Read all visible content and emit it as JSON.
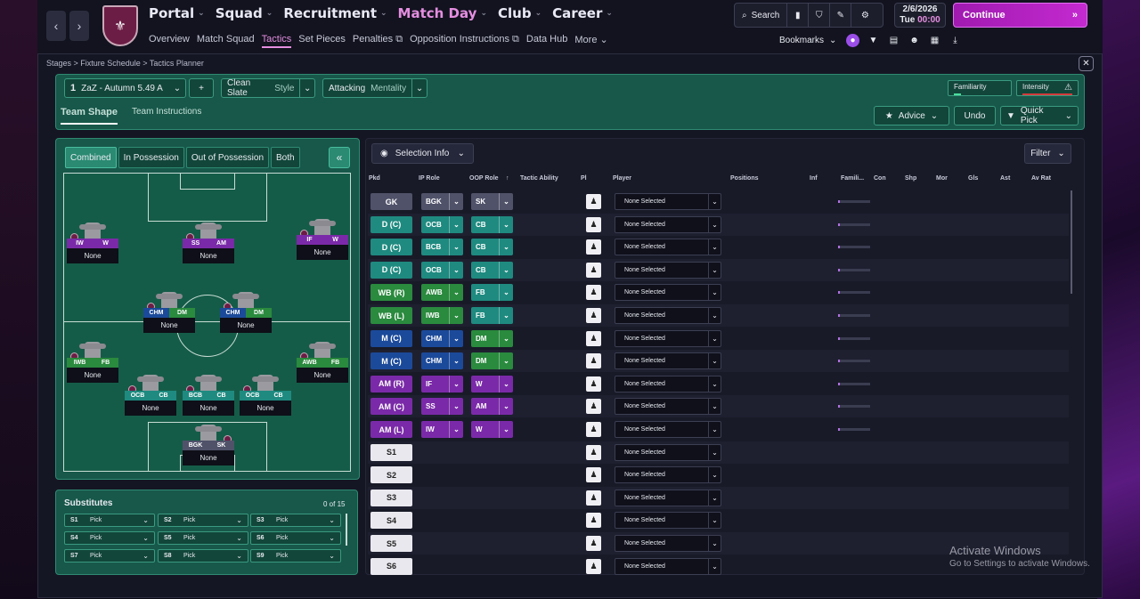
{
  "nav": {
    "main": [
      "Portal",
      "Squad",
      "Recruitment",
      "Match Day",
      "Club",
      "Career"
    ],
    "sub": [
      "Overview",
      "Match Squad",
      "Tactics",
      "Set Pieces",
      "Penalties",
      "Opposition Instructions",
      "Data Hub",
      "More"
    ],
    "search": "Search",
    "date": "2/6/2026",
    "day": "Tue",
    "time": "00:00",
    "continue": "Continue",
    "bookmarks": "Bookmarks"
  },
  "crumbs": "Stages > Fixture Schedule > Tactics Planner",
  "tactic": {
    "num": "1",
    "name": "ZaZ - Autumn 5.49 A",
    "style_label": "Clean Slate",
    "style_sub": "Style",
    "mentality_label": "Attacking",
    "mentality_sub": "Mentality",
    "familiarity": "Familiarity",
    "intensity": "Intensity"
  },
  "tabs": [
    "Team Shape",
    "Team Instructions"
  ],
  "actions": {
    "advice": "Advice",
    "undo": "Undo",
    "quickpick": "Quick Pick"
  },
  "modes": [
    "Combined",
    "In Possession",
    "Out of Possession",
    "Both"
  ],
  "pitch_players": [
    {
      "r1": "IW",
      "r2": "W",
      "name": "None"
    },
    {
      "r1": "SS",
      "r2": "AM",
      "name": "None"
    },
    {
      "r1": "IF",
      "r2": "W",
      "name": "None"
    },
    {
      "r1": "CHM",
      "r2": "DM",
      "name": "None"
    },
    {
      "r1": "CHM",
      "r2": "DM",
      "name": "None"
    },
    {
      "r1": "IWB",
      "r2": "FB",
      "name": "None"
    },
    {
      "r1": "AWB",
      "r2": "FB",
      "name": "None"
    },
    {
      "r1": "OCB",
      "r2": "CB",
      "name": "None"
    },
    {
      "r1": "BCB",
      "r2": "CB",
      "name": "None"
    },
    {
      "r1": "OCB",
      "r2": "CB",
      "name": "None"
    },
    {
      "r1": "BGK",
      "r2": "SK",
      "name": "None"
    }
  ],
  "subs": {
    "title": "Substitutes",
    "count": "0 of 15",
    "slots": [
      {
        "s": "S1",
        "v": "Pick"
      },
      {
        "s": "S2",
        "v": "Pick"
      },
      {
        "s": "S3",
        "v": "Pick"
      },
      {
        "s": "S4",
        "v": "Pick"
      },
      {
        "s": "S5",
        "v": "Pick"
      },
      {
        "s": "S6",
        "v": "Pick"
      },
      {
        "s": "S7",
        "v": "Pick"
      },
      {
        "s": "S8",
        "v": "Pick"
      },
      {
        "s": "S9",
        "v": "Pick"
      }
    ]
  },
  "table": {
    "selinfo": "Selection Info",
    "filter": "Filter",
    "headers": [
      "Pkd",
      "IP Role",
      "OOP Role",
      "Tactic Ability",
      "Pl",
      "Player",
      "Positions",
      "Inf",
      "Famili...",
      "Con",
      "Shp",
      "Mor",
      "Gls",
      "Ast",
      "Av Rat"
    ],
    "rows": [
      {
        "pos": "GK",
        "ip": "BGK",
        "oop": "SK",
        "player": "None Selected"
      },
      {
        "pos": "D (C)",
        "ip": "OCB",
        "oop": "CB",
        "player": "None Selected"
      },
      {
        "pos": "D (C)",
        "ip": "BCB",
        "oop": "CB",
        "player": "None Selected"
      },
      {
        "pos": "D (C)",
        "ip": "OCB",
        "oop": "CB",
        "player": "None Selected"
      },
      {
        "pos": "WB (R)",
        "ip": "AWB",
        "oop": "FB",
        "player": "None Selected"
      },
      {
        "pos": "WB (L)",
        "ip": "IWB",
        "oop": "FB",
        "player": "None Selected"
      },
      {
        "pos": "M (C)",
        "ip": "CHM",
        "oop": "DM",
        "player": "None Selected"
      },
      {
        "pos": "M (C)",
        "ip": "CHM",
        "oop": "DM",
        "player": "None Selected"
      },
      {
        "pos": "AM (R)",
        "ip": "IF",
        "oop": "W",
        "player": "None Selected"
      },
      {
        "pos": "AM (C)",
        "ip": "SS",
        "oop": "AM",
        "player": "None Selected"
      },
      {
        "pos": "AM (L)",
        "ip": "IW",
        "oop": "W",
        "player": "None Selected"
      },
      {
        "pos": "S1",
        "ip": "",
        "oop": "",
        "player": "None Selected"
      },
      {
        "pos": "S2",
        "ip": "",
        "oop": "",
        "player": "None Selected"
      },
      {
        "pos": "S3",
        "ip": "",
        "oop": "",
        "player": "None Selected"
      },
      {
        "pos": "S4",
        "ip": "",
        "oop": "",
        "player": "None Selected"
      },
      {
        "pos": "S5",
        "ip": "",
        "oop": "",
        "player": "None Selected"
      },
      {
        "pos": "S6",
        "ip": "",
        "oop": "",
        "player": "None Selected"
      }
    ]
  },
  "watermark": {
    "l1": "Activate Windows",
    "l2": "Go to Settings to activate Windows."
  }
}
